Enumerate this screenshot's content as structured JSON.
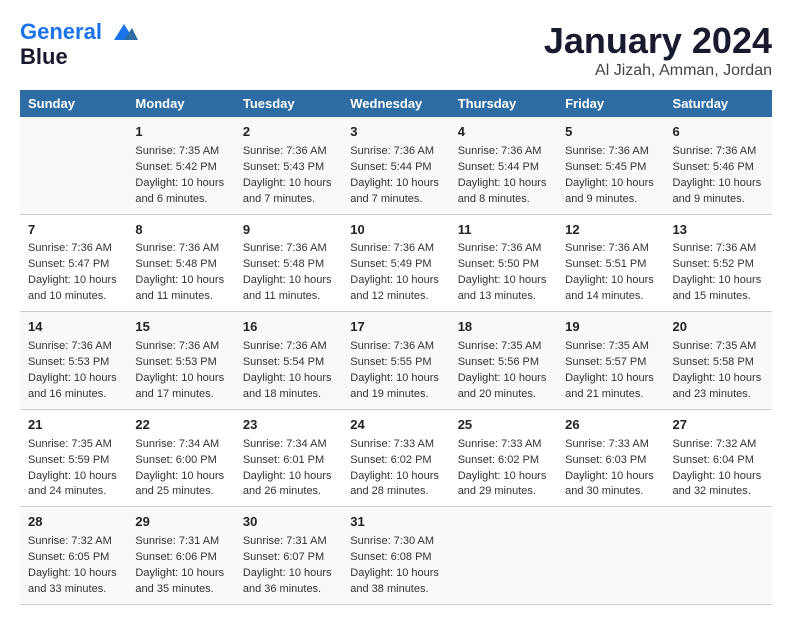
{
  "header": {
    "logo_line1": "General",
    "logo_line2": "Blue",
    "main_title": "January 2024",
    "subtitle": "Al Jizah, Amman, Jordan"
  },
  "days_of_week": [
    "Sunday",
    "Monday",
    "Tuesday",
    "Wednesday",
    "Thursday",
    "Friday",
    "Saturday"
  ],
  "weeks": [
    [
      {
        "num": "",
        "info": ""
      },
      {
        "num": "1",
        "info": "Sunrise: 7:35 AM\nSunset: 5:42 PM\nDaylight: 10 hours\nand 6 minutes."
      },
      {
        "num": "2",
        "info": "Sunrise: 7:36 AM\nSunset: 5:43 PM\nDaylight: 10 hours\nand 7 minutes."
      },
      {
        "num": "3",
        "info": "Sunrise: 7:36 AM\nSunset: 5:44 PM\nDaylight: 10 hours\nand 7 minutes."
      },
      {
        "num": "4",
        "info": "Sunrise: 7:36 AM\nSunset: 5:44 PM\nDaylight: 10 hours\nand 8 minutes."
      },
      {
        "num": "5",
        "info": "Sunrise: 7:36 AM\nSunset: 5:45 PM\nDaylight: 10 hours\nand 9 minutes."
      },
      {
        "num": "6",
        "info": "Sunrise: 7:36 AM\nSunset: 5:46 PM\nDaylight: 10 hours\nand 9 minutes."
      }
    ],
    [
      {
        "num": "7",
        "info": "Sunrise: 7:36 AM\nSunset: 5:47 PM\nDaylight: 10 hours\nand 10 minutes."
      },
      {
        "num": "8",
        "info": "Sunrise: 7:36 AM\nSunset: 5:48 PM\nDaylight: 10 hours\nand 11 minutes."
      },
      {
        "num": "9",
        "info": "Sunrise: 7:36 AM\nSunset: 5:48 PM\nDaylight: 10 hours\nand 11 minutes."
      },
      {
        "num": "10",
        "info": "Sunrise: 7:36 AM\nSunset: 5:49 PM\nDaylight: 10 hours\nand 12 minutes."
      },
      {
        "num": "11",
        "info": "Sunrise: 7:36 AM\nSunset: 5:50 PM\nDaylight: 10 hours\nand 13 minutes."
      },
      {
        "num": "12",
        "info": "Sunrise: 7:36 AM\nSunset: 5:51 PM\nDaylight: 10 hours\nand 14 minutes."
      },
      {
        "num": "13",
        "info": "Sunrise: 7:36 AM\nSunset: 5:52 PM\nDaylight: 10 hours\nand 15 minutes."
      }
    ],
    [
      {
        "num": "14",
        "info": "Sunrise: 7:36 AM\nSunset: 5:53 PM\nDaylight: 10 hours\nand 16 minutes."
      },
      {
        "num": "15",
        "info": "Sunrise: 7:36 AM\nSunset: 5:53 PM\nDaylight: 10 hours\nand 17 minutes."
      },
      {
        "num": "16",
        "info": "Sunrise: 7:36 AM\nSunset: 5:54 PM\nDaylight: 10 hours\nand 18 minutes."
      },
      {
        "num": "17",
        "info": "Sunrise: 7:36 AM\nSunset: 5:55 PM\nDaylight: 10 hours\nand 19 minutes."
      },
      {
        "num": "18",
        "info": "Sunrise: 7:35 AM\nSunset: 5:56 PM\nDaylight: 10 hours\nand 20 minutes."
      },
      {
        "num": "19",
        "info": "Sunrise: 7:35 AM\nSunset: 5:57 PM\nDaylight: 10 hours\nand 21 minutes."
      },
      {
        "num": "20",
        "info": "Sunrise: 7:35 AM\nSunset: 5:58 PM\nDaylight: 10 hours\nand 23 minutes."
      }
    ],
    [
      {
        "num": "21",
        "info": "Sunrise: 7:35 AM\nSunset: 5:59 PM\nDaylight: 10 hours\nand 24 minutes."
      },
      {
        "num": "22",
        "info": "Sunrise: 7:34 AM\nSunset: 6:00 PM\nDaylight: 10 hours\nand 25 minutes."
      },
      {
        "num": "23",
        "info": "Sunrise: 7:34 AM\nSunset: 6:01 PM\nDaylight: 10 hours\nand 26 minutes."
      },
      {
        "num": "24",
        "info": "Sunrise: 7:33 AM\nSunset: 6:02 PM\nDaylight: 10 hours\nand 28 minutes."
      },
      {
        "num": "25",
        "info": "Sunrise: 7:33 AM\nSunset: 6:02 PM\nDaylight: 10 hours\nand 29 minutes."
      },
      {
        "num": "26",
        "info": "Sunrise: 7:33 AM\nSunset: 6:03 PM\nDaylight: 10 hours\nand 30 minutes."
      },
      {
        "num": "27",
        "info": "Sunrise: 7:32 AM\nSunset: 6:04 PM\nDaylight: 10 hours\nand 32 minutes."
      }
    ],
    [
      {
        "num": "28",
        "info": "Sunrise: 7:32 AM\nSunset: 6:05 PM\nDaylight: 10 hours\nand 33 minutes."
      },
      {
        "num": "29",
        "info": "Sunrise: 7:31 AM\nSunset: 6:06 PM\nDaylight: 10 hours\nand 35 minutes."
      },
      {
        "num": "30",
        "info": "Sunrise: 7:31 AM\nSunset: 6:07 PM\nDaylight: 10 hours\nand 36 minutes."
      },
      {
        "num": "31",
        "info": "Sunrise: 7:30 AM\nSunset: 6:08 PM\nDaylight: 10 hours\nand 38 minutes."
      },
      {
        "num": "",
        "info": ""
      },
      {
        "num": "",
        "info": ""
      },
      {
        "num": "",
        "info": ""
      }
    ]
  ]
}
